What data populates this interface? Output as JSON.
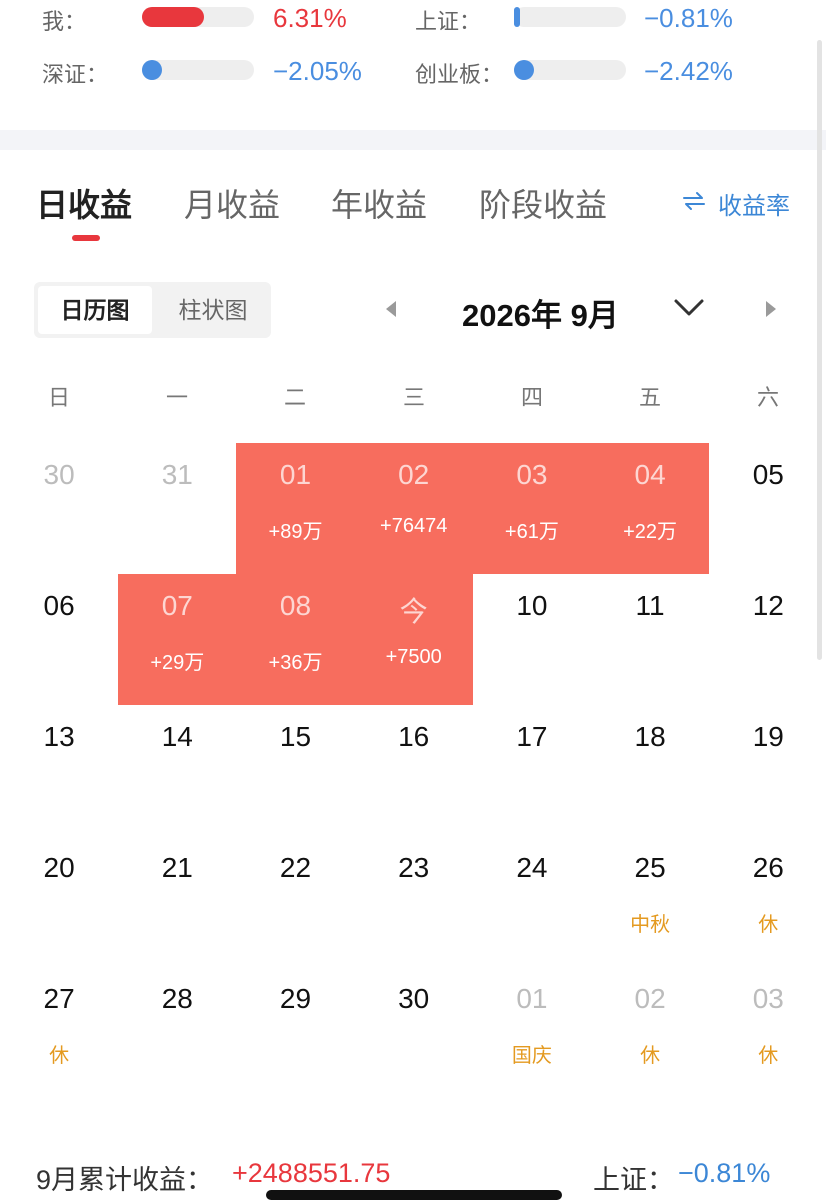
{
  "comparison": {
    "rows": [
      {
        "label": "我：",
        "value": "6.31%",
        "level": 0.55,
        "color": "#e8373d"
      },
      {
        "label": "上证：",
        "value": "−0.81%",
        "level": 0.04,
        "color": "#4a8ee0"
      },
      {
        "label": "深证：",
        "value": "−2.05%",
        "level": 0.0,
        "color": "#4a8ee0"
      },
      {
        "label": "创业板：",
        "value": "−2.42%",
        "level": 0.0,
        "color": "#4a8ee0"
      }
    ]
  },
  "tabs": [
    "日收益",
    "月收益",
    "年收益",
    "阶段收益"
  ],
  "active_tab": 0,
  "ratio_toggle": {
    "icon": "swap-arrows-icon",
    "label": "收益率"
  },
  "view_switch": {
    "active": "日历图",
    "inactive": "柱状图"
  },
  "month_nav": {
    "label": "2026年 9月",
    "prev_icon": "triangle-left-icon",
    "next_icon": "triangle-right-icon",
    "dropdown_icon": "chevron-down-icon"
  },
  "weekdays": [
    "日",
    "一",
    "二",
    "三",
    "四",
    "五",
    "六"
  ],
  "colors": {
    "positive": "#f76d5e",
    "gain_text": "#e8373d",
    "loss_text": "#3c87d6",
    "holiday": "#e49a20"
  },
  "calendar": [
    [
      {
        "d": "30",
        "muted": true
      },
      {
        "d": "31",
        "muted": true
      },
      {
        "d": "01",
        "pl": "+89万"
      },
      {
        "d": "02",
        "pl": "+76474"
      },
      {
        "d": "03",
        "pl": "+61万"
      },
      {
        "d": "04",
        "pl": "+22万"
      },
      {
        "d": "05"
      }
    ],
    [
      {
        "d": "06"
      },
      {
        "d": "07",
        "pl": "+29万"
      },
      {
        "d": "08",
        "pl": "+36万"
      },
      {
        "d": "今",
        "pl": "+7500"
      },
      {
        "d": "10"
      },
      {
        "d": "11"
      },
      {
        "d": "12"
      }
    ],
    [
      {
        "d": "13"
      },
      {
        "d": "14"
      },
      {
        "d": "15"
      },
      {
        "d": "16"
      },
      {
        "d": "17"
      },
      {
        "d": "18"
      },
      {
        "d": "19"
      }
    ],
    [
      {
        "d": "20"
      },
      {
        "d": "21"
      },
      {
        "d": "22"
      },
      {
        "d": "23"
      },
      {
        "d": "24"
      },
      {
        "d": "25",
        "note": "中秋"
      },
      {
        "d": "26",
        "note": "休"
      }
    ],
    [
      {
        "d": "27",
        "note": "休"
      },
      {
        "d": "28"
      },
      {
        "d": "29"
      },
      {
        "d": "30"
      },
      {
        "d": "01",
        "muted": true,
        "note": "国庆"
      },
      {
        "d": "02",
        "muted": true,
        "note": "休"
      },
      {
        "d": "03",
        "muted": true,
        "note": "休"
      }
    ]
  ],
  "summary": {
    "label": "9月累计收益：",
    "value": "+2488551.75",
    "index_label": "上证：",
    "index_value": "−0.81%"
  }
}
